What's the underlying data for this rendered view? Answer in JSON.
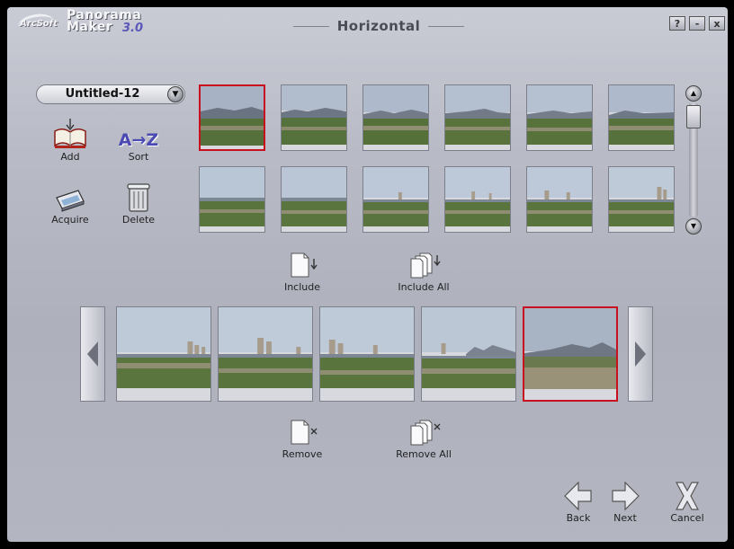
{
  "app": {
    "brand": "ArcSoft",
    "product_line1": "Panorama",
    "product_line2": "Maker",
    "version": "3.0",
    "title": "Horizontal"
  },
  "window_buttons": {
    "help": "?",
    "minimize": "-",
    "close": "x"
  },
  "project": {
    "name": "Untitled-12"
  },
  "tools": {
    "add": "Add",
    "sort": "Sort",
    "acquire": "Acquire",
    "delete": "Delete",
    "sort_icon_text": "A→Z"
  },
  "actions": {
    "include": "Include",
    "include_all": "Include All",
    "remove": "Remove",
    "remove_all": "Remove All"
  },
  "nav": {
    "back": "Back",
    "next": "Next",
    "cancel": "Cancel"
  },
  "colors": {
    "selection": "#c8101e",
    "window_bg": "#b9bbc6"
  }
}
